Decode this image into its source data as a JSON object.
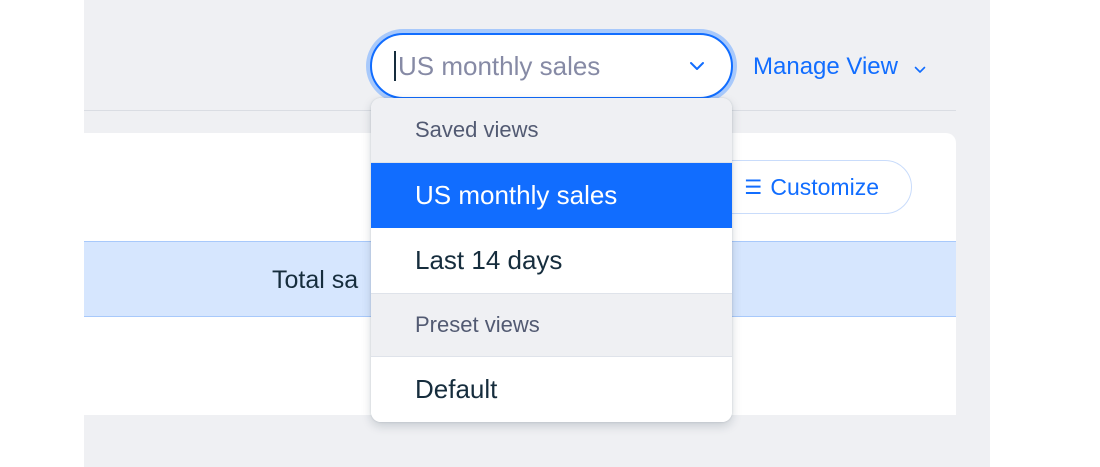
{
  "view_selector": {
    "value": "US monthly sales",
    "state": "open"
  },
  "manage_view": {
    "label": "Manage View"
  },
  "toolbar": {
    "customize_label": "Customize"
  },
  "table": {
    "column_header_visible": "Total sa"
  },
  "dropdown": {
    "saved_section_label": "Saved views",
    "saved_views": [
      {
        "label": "US monthly sales",
        "selected": true
      },
      {
        "label": "Last 14 days",
        "selected": false
      }
    ],
    "preset_section_label": "Preset views",
    "preset_views": [
      {
        "label": "Default",
        "selected": false
      }
    ]
  },
  "colors": {
    "accent": "#116dff",
    "text_primary": "#162d3d",
    "section_bg": "#eff0f3",
    "table_header_bg": "#d6e6fe"
  },
  "icons": {
    "select_chevron": "chevron-down-icon",
    "manage_view_chevron": "chevron-down-icon",
    "customize": "menu-lines-icon"
  }
}
